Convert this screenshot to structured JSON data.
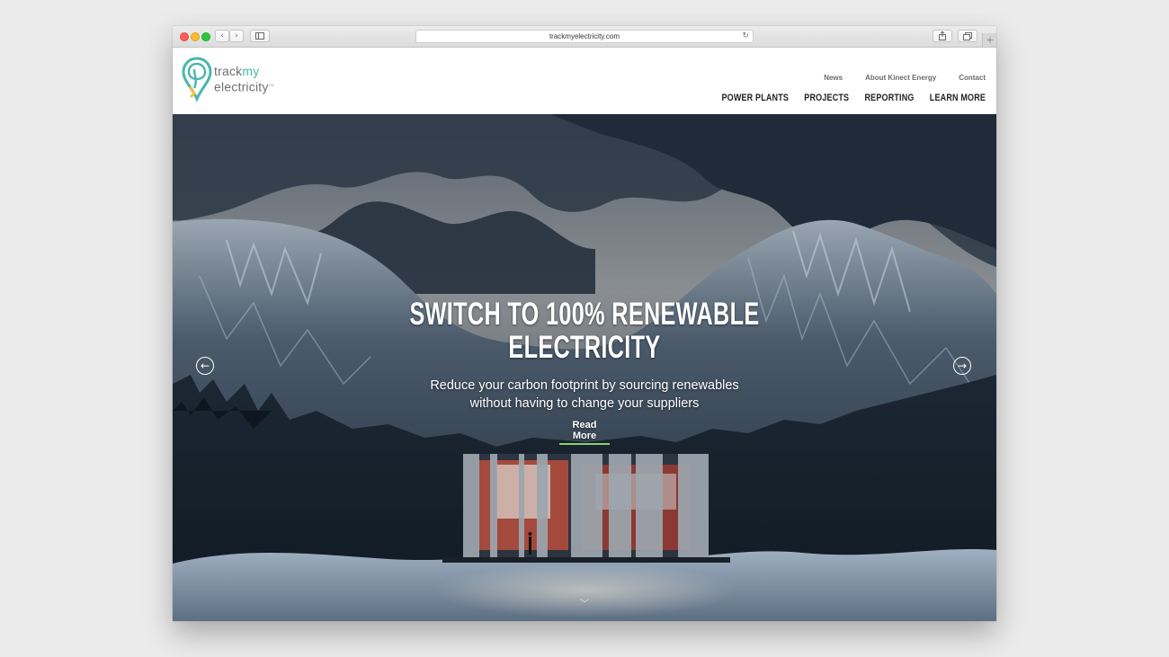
{
  "browser": {
    "url": "trackmyelectricity.com",
    "back_glyph": "‹",
    "forward_glyph": "›",
    "reload_glyph": "↻",
    "new_tab_glyph": "+"
  },
  "logo": {
    "line1_a": "track",
    "line1_b": "my",
    "line2": "electricity",
    "tm": "TM",
    "colors": {
      "teal": "#49b7ad",
      "yellow": "#f2c23a",
      "gray": "#6f6f6f"
    }
  },
  "util_nav": [
    "News",
    "About Kinect Energy",
    "Contact"
  ],
  "main_nav": [
    "POWER PLANTS",
    "PROJECTS",
    "REPORTING",
    "LEARN MORE"
  ],
  "hero": {
    "title_line1": "SWITCH TO 100% RENEWABLE",
    "title_line2": "ELECTRICITY",
    "subtitle_line1": "Reduce your carbon footprint by sourcing renewables",
    "subtitle_line2": "without having to change your suppliers",
    "cta": "Read More",
    "cta_underline_color": "#8dd16a",
    "prev_glyph": "←",
    "next_glyph": "→",
    "scroll_glyph": "﹀"
  }
}
